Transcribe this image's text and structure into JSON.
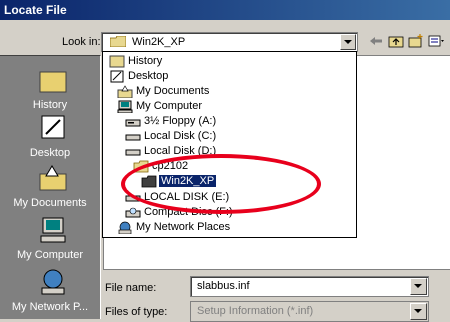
{
  "window": {
    "title": "Locate File"
  },
  "lookin": {
    "label": "Look in:",
    "value": "Win2K_XP"
  },
  "places": [
    {
      "label": "History"
    },
    {
      "label": "Desktop"
    },
    {
      "label": "My Documents"
    },
    {
      "label": "My Computer"
    },
    {
      "label": "My Network P..."
    }
  ],
  "dropdown": {
    "items": [
      {
        "label": "History"
      },
      {
        "label": "Desktop"
      },
      {
        "label": "My Documents"
      },
      {
        "label": "My Computer"
      },
      {
        "label": "3½ Floppy (A:)"
      },
      {
        "label": "Local Disk (C:)"
      },
      {
        "label": "Local Disk (D:)"
      },
      {
        "label": "cp2102"
      },
      {
        "label": "Win2K_XP"
      },
      {
        "label": "LOCAL DISK (E:)"
      },
      {
        "label": "Compact Disc (F:)"
      },
      {
        "label": "My Network Places"
      }
    ],
    "selected": "Win2K_XP"
  },
  "filename": {
    "label": "File name:",
    "value": "slabbus.inf"
  },
  "filetype": {
    "label": "Files of type:",
    "value": "Setup Information (*.inf)"
  },
  "colors": {
    "title_bar": "#0a246a",
    "selection": "#0a246a",
    "annotation": "#e8001c",
    "places_bg": "#808080"
  }
}
